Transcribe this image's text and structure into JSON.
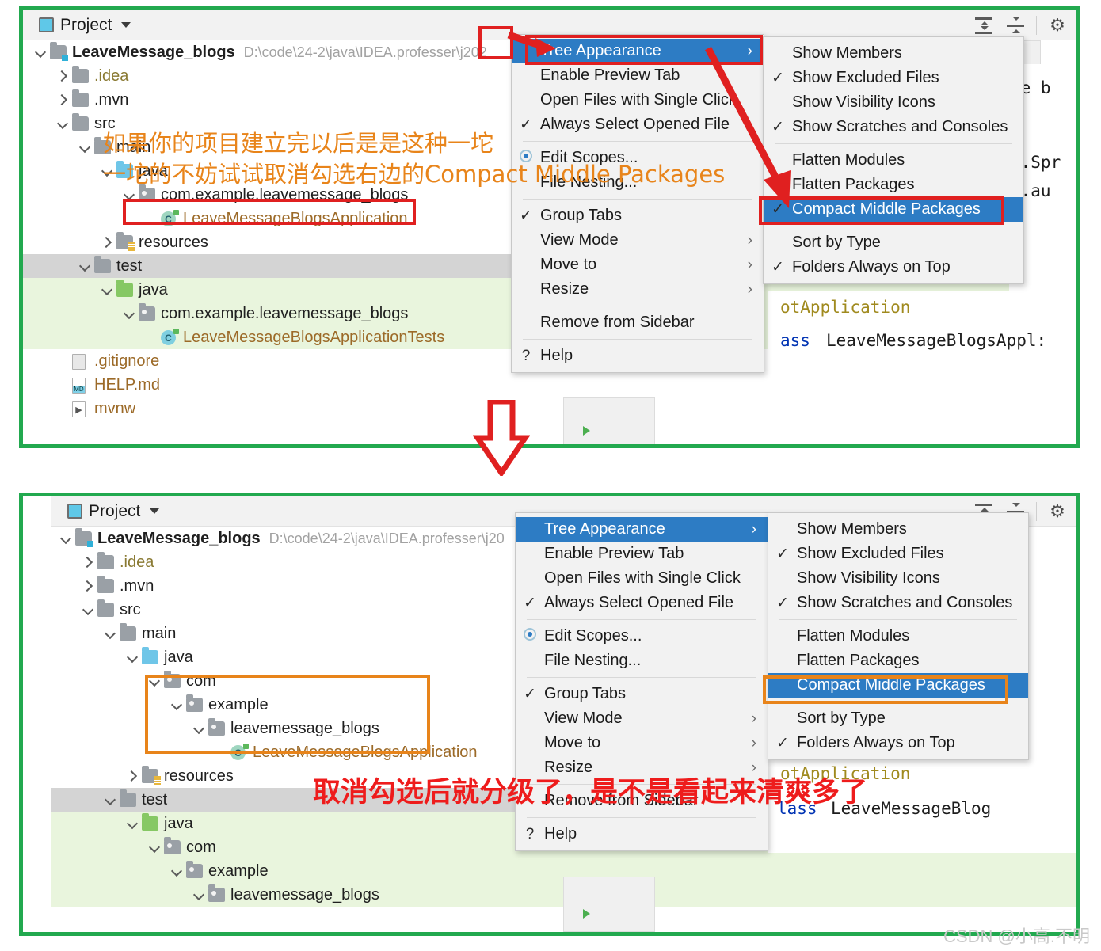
{
  "app": {
    "tool_window_title": "Project",
    "project_name": "LeaveMessage_blogs",
    "project_path": "D:\\code\\24-2\\java\\IDEA.professer\\j202",
    "project_path_short": "D:\\code\\24-2\\java\\IDEA.professer\\j20"
  },
  "toolbar": {
    "expand_all_icon": "expand-all-icon",
    "collapse_all_icon": "collapse-all-icon",
    "settings_icon": "gear-icon"
  },
  "tree_top": [
    {
      "label": "LeaveMessage_blogs",
      "path": "D:\\code\\24-2\\java\\IDEA.professer\\j202",
      "indent": 0,
      "arrow": "down",
      "icon": "module-folder",
      "style": "bold"
    },
    {
      "label": ".idea",
      "indent": 1,
      "arrow": "right",
      "icon": "folder",
      "style": "olive"
    },
    {
      "label": ".mvn",
      "indent": 1,
      "arrow": "right",
      "icon": "folder",
      "style": "normal"
    },
    {
      "label": "src",
      "indent": 1,
      "arrow": "down",
      "icon": "folder",
      "style": "normal"
    },
    {
      "label": "main",
      "indent": 2,
      "arrow": "down",
      "icon": "folder",
      "style": "normal"
    },
    {
      "label": "java",
      "indent": 3,
      "arrow": "down",
      "icon": "folder-blue",
      "style": "normal"
    },
    {
      "label": "com.example.leavemessage_blogs",
      "indent": 4,
      "arrow": "down",
      "icon": "package",
      "style": "normal"
    },
    {
      "label": "LeaveMessageBlogsApplication",
      "indent": 5,
      "arrow": "none",
      "icon": "class-run",
      "style": "brown"
    },
    {
      "label": "resources",
      "indent": 3,
      "arrow": "right",
      "icon": "resources-folder",
      "style": "normal"
    },
    {
      "label": "test",
      "indent": 2,
      "arrow": "down",
      "icon": "folder",
      "style": "normal",
      "row": "sel-gray"
    },
    {
      "label": "java",
      "indent": 3,
      "arrow": "down",
      "icon": "folder-green",
      "style": "normal",
      "row": "sel-green"
    },
    {
      "label": "com.example.leavemessage_blogs",
      "indent": 4,
      "arrow": "down",
      "icon": "package",
      "style": "normal",
      "row": "sel-green"
    },
    {
      "label": "LeaveMessageBlogsApplicationTests",
      "indent": 5,
      "arrow": "none",
      "icon": "class-test",
      "style": "brown",
      "row": "sel-green"
    },
    {
      "label": ".gitignore",
      "indent": 1,
      "arrow": "none",
      "icon": "file-gitignore",
      "style": "brown"
    },
    {
      "label": "HELP.md",
      "indent": 1,
      "arrow": "none",
      "icon": "file-md",
      "style": "brown"
    },
    {
      "label": "mvnw",
      "indent": 1,
      "arrow": "none",
      "icon": "file-sh",
      "style": "brown"
    }
  ],
  "tree_bottom": [
    {
      "label": "LeaveMessage_blogs",
      "path": "D:\\code\\24-2\\java\\IDEA.professer\\j20",
      "indent": 0,
      "arrow": "down",
      "icon": "module-folder",
      "style": "bold"
    },
    {
      "label": ".idea",
      "indent": 1,
      "arrow": "right",
      "icon": "folder",
      "style": "olive"
    },
    {
      "label": ".mvn",
      "indent": 1,
      "arrow": "right",
      "icon": "folder",
      "style": "normal"
    },
    {
      "label": "src",
      "indent": 1,
      "arrow": "down",
      "icon": "folder",
      "style": "normal"
    },
    {
      "label": "main",
      "indent": 2,
      "arrow": "down",
      "icon": "folder",
      "style": "normal"
    },
    {
      "label": "java",
      "indent": 3,
      "arrow": "down",
      "icon": "folder-blue",
      "style": "normal"
    },
    {
      "label": "com",
      "indent": 4,
      "arrow": "down",
      "icon": "package",
      "style": "normal"
    },
    {
      "label": "example",
      "indent": 5,
      "arrow": "down",
      "icon": "package",
      "style": "normal"
    },
    {
      "label": "leavemessage_blogs",
      "indent": 6,
      "arrow": "down",
      "icon": "package",
      "style": "normal"
    },
    {
      "label": "LeaveMessageBlogsApplication",
      "indent": 7,
      "arrow": "none",
      "icon": "class-run",
      "style": "brown"
    },
    {
      "label": "resources",
      "indent": 3,
      "arrow": "right",
      "icon": "resources-folder",
      "style": "normal"
    },
    {
      "label": "test",
      "indent": 2,
      "arrow": "down",
      "icon": "folder",
      "style": "normal",
      "row": "sel-gray"
    },
    {
      "label": "java",
      "indent": 3,
      "arrow": "down",
      "icon": "folder-green",
      "style": "normal",
      "row": "sel-green"
    },
    {
      "label": "com",
      "indent": 4,
      "arrow": "down",
      "icon": "package",
      "style": "normal",
      "row": "sel-green"
    },
    {
      "label": "example",
      "indent": 5,
      "arrow": "down",
      "icon": "package",
      "style": "normal",
      "row": "sel-green"
    },
    {
      "label": "leavemessage_blogs",
      "indent": 6,
      "arrow": "down",
      "icon": "package",
      "style": "normal",
      "row": "sel-green"
    }
  ],
  "menu_main": {
    "items": [
      {
        "label": "Tree Appearance",
        "checked": false,
        "submenu": true,
        "highlighted": true
      },
      {
        "label": "Enable Preview Tab",
        "checked": false
      },
      {
        "label": "Open Files with Single Click",
        "checked": false
      },
      {
        "label": "Always Select Opened File",
        "checked": true
      },
      {
        "separator": true
      },
      {
        "label": "Edit Scopes...",
        "radio": true
      },
      {
        "label": "File Nesting...",
        "checked": false
      },
      {
        "separator": true
      },
      {
        "label": "Group Tabs",
        "checked": true
      },
      {
        "label": "View Mode",
        "submenu": true
      },
      {
        "label": "Move to",
        "submenu": true
      },
      {
        "label": "Resize",
        "submenu": true
      },
      {
        "separator": true
      },
      {
        "label": "Remove from Sidebar",
        "checked": false
      },
      {
        "separator": true
      },
      {
        "label": "Help",
        "help": true
      }
    ]
  },
  "menu_sub": {
    "items": [
      {
        "label": "Show Members",
        "checked": false
      },
      {
        "label": "Show Excluded Files",
        "checked": true
      },
      {
        "label": "Show Visibility Icons",
        "checked": false
      },
      {
        "label": "Show Scratches and Consoles",
        "checked": true
      },
      {
        "separator": true
      },
      {
        "label": "Flatten Modules",
        "checked": false
      },
      {
        "label": "Flatten Packages",
        "checked": false
      },
      {
        "label": "Compact Middle Packages",
        "checked": true,
        "highlighted": true
      },
      {
        "separator": true
      },
      {
        "label": "Sort by Type",
        "checked": false
      },
      {
        "label": "Folders Always on Top",
        "checked": true
      }
    ]
  },
  "menu_sub_bottom": {
    "items": [
      {
        "label": "Show Members",
        "checked": false
      },
      {
        "label": "Show Excluded Files",
        "checked": true
      },
      {
        "label": "Show Visibility Icons",
        "checked": false
      },
      {
        "label": "Show Scratches and Consoles",
        "checked": true
      },
      {
        "separator": true
      },
      {
        "label": "Flatten Modules",
        "checked": false
      },
      {
        "label": "Flatten Packages",
        "checked": false
      },
      {
        "label": "Compact Middle Packages",
        "checked": false,
        "highlighted": true
      },
      {
        "separator": true
      },
      {
        "label": "Sort by Type",
        "checked": false
      },
      {
        "label": "Folders Always on Top",
        "checked": true
      }
    ]
  },
  "editor_top": {
    "line_package": "ge_b",
    "line_import1": "t.Spr",
    "line_import2": "t.au",
    "line_annotation": "otApplication",
    "line_class_kw": "ass",
    "line_class_name": "LeaveMessageBlogsAppl:"
  },
  "editor_bottom": {
    "line_annotation": "otApplication",
    "line_class_kw": "lass",
    "line_class_name": "LeaveMessageBlog"
  },
  "annotations": {
    "orange_line1": "如果你的项目建立完以后是是这种一坨",
    "orange_line2": "一坨的不妨试试取消勾选右边的Compact Middle Packages",
    "red_line": "取消勾选后就分级了，是不是看起来清爽多了"
  },
  "watermark": "CSDN @小高.不明",
  "colors": {
    "frame_green": "#22a94f",
    "highlight_blue": "#2d7cc4",
    "callout_red": "#e02020",
    "callout_orange": "#e8841a",
    "selection_gray": "#d4d4d4",
    "selection_green": "#e9f5dd"
  }
}
